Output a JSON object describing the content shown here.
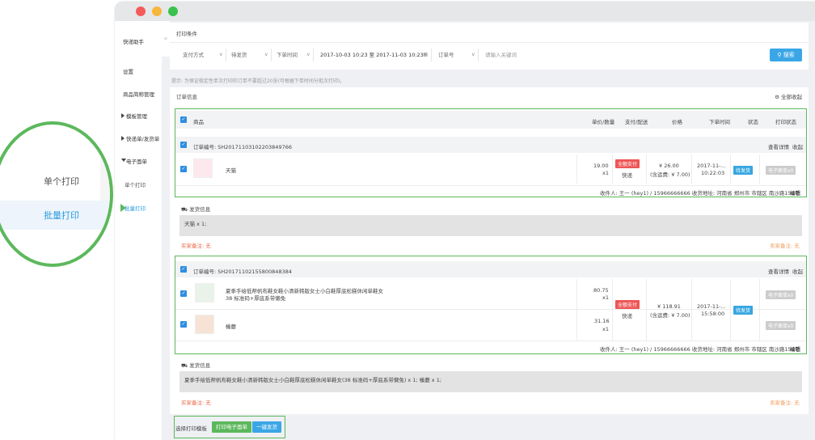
{
  "sidebar": {
    "title": "快递助手",
    "items": [
      {
        "label": "设置"
      },
      {
        "label": "商品简称管理"
      },
      {
        "label": "模板管理"
      },
      {
        "label": "快递单/发货单"
      },
      {
        "label": "电子面单"
      },
      {
        "label": "单个打印"
      },
      {
        "label": "批量打印"
      }
    ]
  },
  "zoom": {
    "single": "单个打印",
    "batch": "批量打印"
  },
  "filters": {
    "title": "打印条件",
    "payment": "支付方式",
    "ship_status": "待发货",
    "time_type": "下单时间",
    "date_start": "2017-10-03 10:23",
    "date_sep": "至",
    "date_end": "2017-11-03 10:23",
    "id_type": "订单号",
    "keyword_placeholder": "请输入关键词",
    "search": "搜索"
  },
  "tip": "提示: 为保证稳定性单次打印的订单不要超过20张(可根据下单时间分批次打印)。",
  "orders_title": "订单信息",
  "collapse_all": "全部收起",
  "columns": {
    "product": "商品",
    "unit": "单价/数量",
    "pay": "支付/配送",
    "price": "价格",
    "time": "下单时间",
    "status": "状态",
    "print": "打印状态"
  },
  "order1": {
    "id_label": "订单编号: SH20171103102203849766",
    "detail": "查看详情",
    "fold": "收起",
    "item": {
      "name": "天猫",
      "unit": "19.00",
      "qty": "x1"
    },
    "pay_badge": "全额支付",
    "delivery": "快递",
    "price": "¥ 26.00",
    "freight": "(含运费: ¥ 7.00)",
    "date": "2017-11-...",
    "time": "10:22:03",
    "status": "待发货",
    "print": "电子面单x0",
    "address": "收件人: 王一 (hey1) / 15966666666 收货地址: 河南省 郑州市 市辖区 南沙路159号",
    "edit": "编辑",
    "ship_title": "发货信息",
    "ship_content": "天猫 x 1;",
    "buyer_note": "买家备注: 无",
    "seller_note": "卖家备注: 无"
  },
  "order2": {
    "id_label": "订单编号: SH20171102155800848384",
    "detail": "查看详情",
    "fold": "收起",
    "items": [
      {
        "name1": "夏季手绘低帮帆布鞋女鞋小清新韩版女士小白鞋厚底松糕休闲单鞋女",
        "name2": "38 标准码+厚底系带懒免",
        "unit": "80.75",
        "qty": "x1"
      },
      {
        "name1": "榛蘑",
        "name2": "",
        "unit": "31.16",
        "qty": "x1"
      }
    ],
    "pay_badge": "全额支付",
    "delivery": "快递",
    "price": "¥ 118.91",
    "freight": "(含运费: ¥ 7.00)",
    "date": "2017-11-...",
    "time": "15:58:00",
    "status": "待发货",
    "print1": "电子面单x0",
    "print2": "电子面单x0",
    "address": "收件人: 王一 (hey1) / 15966666666 收货地址: 河南省 郑州市 市辖区 南沙路159号",
    "edit": "编辑",
    "ship_title": "发货信息",
    "ship_content": "夏季手绘低帮帆布鞋女鞋小清新韩版女士小白鞋厚底松糕休闲单鞋女(38 标准码+厚底系带懒免) x 1; 榛蘑 x 1;",
    "buyer_note": "买家备注: 无",
    "seller_note": "卖家备注: 无"
  },
  "footer": {
    "label": "选择打印模板",
    "print_btn": "打印电子面单",
    "ship_btn": "一键发货"
  },
  "colors": {
    "accent": "#3ba6e6",
    "green": "#5cb85c",
    "red": "#e55555"
  }
}
